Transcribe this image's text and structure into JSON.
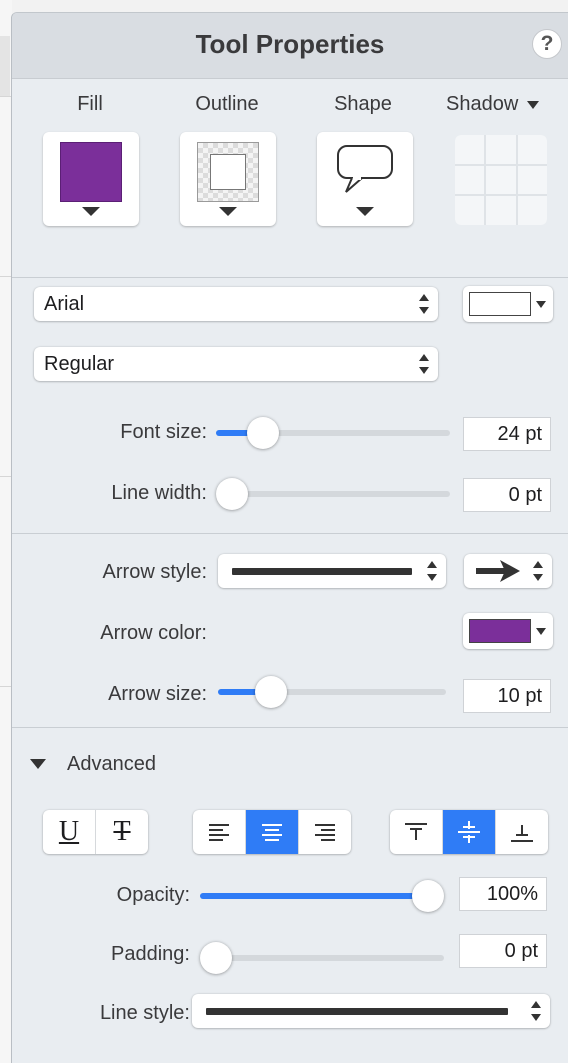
{
  "window": {
    "title": "Tool Properties",
    "help_label": "?"
  },
  "style_tabs": {
    "fill": {
      "label": "Fill",
      "color": "#7b2f9a"
    },
    "outline": {
      "label": "Outline"
    },
    "shape": {
      "label": "Shape"
    },
    "shadow": {
      "label": "Shadow"
    }
  },
  "text": {
    "font_family": "Arial",
    "font_style": "Regular",
    "text_color": "#ffffff",
    "font_size": {
      "label": "Font size:",
      "value": "24 pt",
      "level": 0.15
    },
    "line_width": {
      "label": "Line width:",
      "value": "0 pt",
      "level": 0.0
    }
  },
  "arrow": {
    "style_label": "Arrow style:",
    "color_label": "Arrow color:",
    "color": "#7b2f9a",
    "size": {
      "label": "Arrow size:",
      "value": "10 pt",
      "level": 0.2
    }
  },
  "advanced": {
    "label": "Advanced",
    "underline_glyph": "U",
    "strikethrough_glyph": "T",
    "opacity": {
      "label": "Opacity:",
      "value": "100%",
      "level": 1.0
    },
    "padding": {
      "label": "Padding:",
      "value": "0 pt",
      "level": 0.0
    },
    "line_style_label": "Line style:"
  },
  "colors": {
    "accent": "#2f7cf6",
    "panel_bg": "#e9edf1",
    "titlebar_bg": "#d9dde2"
  }
}
